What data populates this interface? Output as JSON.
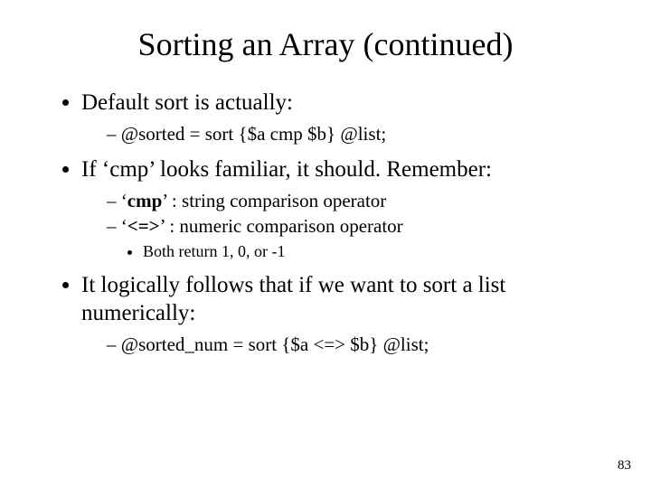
{
  "title": "Sorting an Array (continued)",
  "bullets": {
    "b1": "Default sort is actually:",
    "b1_sub1": "@sorted = sort {$a cmp $b} @list;",
    "b2_pre": "If ",
    "b2_quote": "‘cmp’",
    "b2_post": " looks familiar, it should.  Remember:",
    "b2_sub1_pre": "‘",
    "b2_sub1_bold": "cmp",
    "b2_sub1_post": "’ : string comparison operator",
    "b2_sub2_pre": "‘",
    "b2_sub2_bold": "<=>",
    "b2_sub2_post": "’ : numeric comparison operator",
    "b2_sub2_sub1": "Both return 1, 0, or -1",
    "b3": "It logically follows that if we want to sort a list numerically:",
    "b3_sub1": "@sorted_num = sort {$a <=> $b} @list;"
  },
  "page_number": "83"
}
